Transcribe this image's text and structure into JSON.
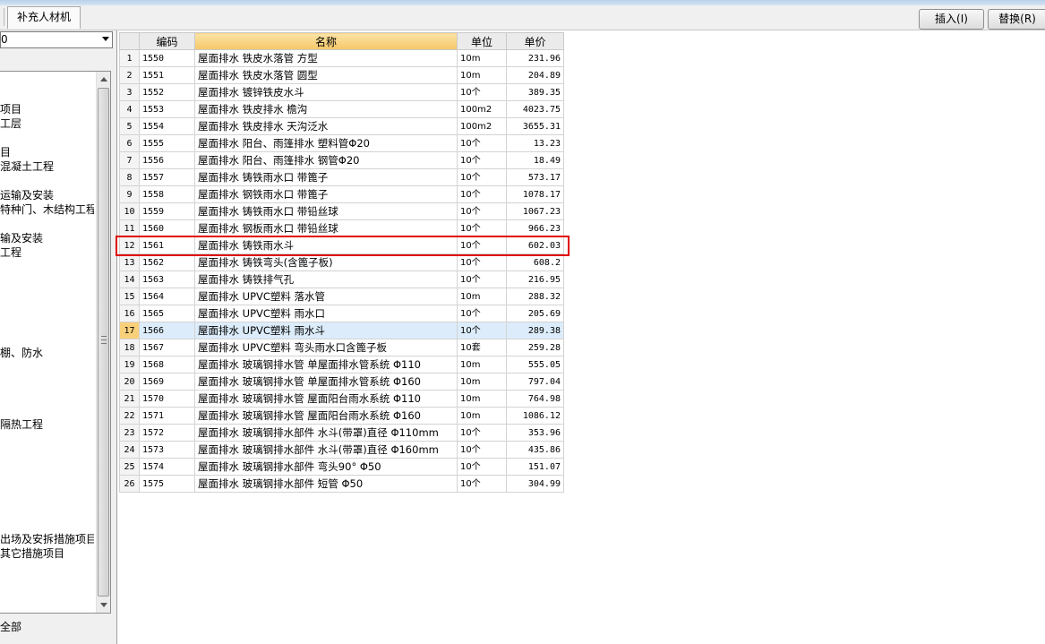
{
  "toolbar": {
    "tab_label": "补充人材机",
    "insert_label": "插入(I)",
    "replace_label": "替换(R)"
  },
  "left_panel": {
    "combo_value": "0",
    "tree_items": [
      "项目",
      "工层",
      "目",
      "混凝土工程",
      "运输及安装",
      "特种门、木结构工程",
      "输及安装",
      "工程",
      "棚、防水",
      "隔热工程",
      "出场及安拆措施项目",
      "其它措施项目"
    ],
    "all_label": "全部"
  },
  "grid": {
    "columns": [
      "编码",
      "名称",
      "单位",
      "单价"
    ],
    "active_column": "名称",
    "selected_row": 17,
    "highlighted_row": 12,
    "rows": [
      {
        "idx": "1",
        "code": "1550",
        "name": "屋面排水 铁皮水落管 方型",
        "unit": "10m",
        "price": "231.96"
      },
      {
        "idx": "2",
        "code": "1551",
        "name": "屋面排水 铁皮水落管 圆型",
        "unit": "10m",
        "price": "204.89"
      },
      {
        "idx": "3",
        "code": "1552",
        "name": "屋面排水 镀锌铁皮水斗",
        "unit": "10个",
        "price": "389.35"
      },
      {
        "idx": "4",
        "code": "1553",
        "name": "屋面排水 铁皮排水 檐沟",
        "unit": "100m2",
        "price": "4023.75"
      },
      {
        "idx": "5",
        "code": "1554",
        "name": "屋面排水 铁皮排水 天沟泛水",
        "unit": "100m2",
        "price": "3655.31"
      },
      {
        "idx": "6",
        "code": "1555",
        "name": "屋面排水 阳台、雨篷排水 塑料管Φ20",
        "unit": "10个",
        "price": "13.23"
      },
      {
        "idx": "7",
        "code": "1556",
        "name": "屋面排水 阳台、雨篷排水 钢管Φ20",
        "unit": "10个",
        "price": "18.49"
      },
      {
        "idx": "8",
        "code": "1557",
        "name": "屋面排水 铸铁雨水口 带篦子",
        "unit": "10个",
        "price": "573.17"
      },
      {
        "idx": "9",
        "code": "1558",
        "name": "屋面排水 钢铁雨水口 带篦子",
        "unit": "10个",
        "price": "1078.17"
      },
      {
        "idx": "10",
        "code": "1559",
        "name": "屋面排水 铸铁雨水口 带铅丝球",
        "unit": "10个",
        "price": "1067.23"
      },
      {
        "idx": "11",
        "code": "1560",
        "name": "屋面排水 钢板雨水口 带铅丝球",
        "unit": "10个",
        "price": "966.23"
      },
      {
        "idx": "12",
        "code": "1561",
        "name": "屋面排水 铸铁雨水斗",
        "unit": "10个",
        "price": "602.03"
      },
      {
        "idx": "13",
        "code": "1562",
        "name": "屋面排水 铸铁弯头(含篦子板)",
        "unit": "10个",
        "price": "608.2"
      },
      {
        "idx": "14",
        "code": "1563",
        "name": "屋面排水 铸铁排气孔",
        "unit": "10个",
        "price": "216.95"
      },
      {
        "idx": "15",
        "code": "1564",
        "name": "屋面排水 UPVC塑料 落水管",
        "unit": "10m",
        "price": "288.32"
      },
      {
        "idx": "16",
        "code": "1565",
        "name": "屋面排水 UPVC塑料 雨水口",
        "unit": "10个",
        "price": "205.69"
      },
      {
        "idx": "17",
        "code": "1566",
        "name": "屋面排水 UPVC塑料 雨水斗",
        "unit": "10个",
        "price": "289.38"
      },
      {
        "idx": "18",
        "code": "1567",
        "name": "屋面排水 UPVC塑料 弯头雨水口含篦子板",
        "unit": "10套",
        "price": "259.28"
      },
      {
        "idx": "19",
        "code": "1568",
        "name": "屋面排水 玻璃钢排水管 单屋面排水管系统 Φ110",
        "unit": "10m",
        "price": "555.05"
      },
      {
        "idx": "20",
        "code": "1569",
        "name": "屋面排水 玻璃钢排水管 单屋面排水管系统 Φ160",
        "unit": "10m",
        "price": "797.04"
      },
      {
        "idx": "21",
        "code": "1570",
        "name": "屋面排水 玻璃钢排水管 屋面阳台雨水系统 Φ110",
        "unit": "10m",
        "price": "764.98"
      },
      {
        "idx": "22",
        "code": "1571",
        "name": "屋面排水 玻璃钢排水管 屋面阳台雨水系统 Φ160",
        "unit": "10m",
        "price": "1086.12"
      },
      {
        "idx": "23",
        "code": "1572",
        "name": "屋面排水 玻璃钢排水部件 水斗(带罩)直径 Φ110mm",
        "unit": "10个",
        "price": "353.96"
      },
      {
        "idx": "24",
        "code": "1573",
        "name": "屋面排水 玻璃钢排水部件 水斗(带罩)直径 Φ160mm",
        "unit": "10个",
        "price": "435.86"
      },
      {
        "idx": "25",
        "code": "1574",
        "name": "屋面排水 玻璃钢排水部件 弯头90° Φ50",
        "unit": "10个",
        "price": "151.07"
      },
      {
        "idx": "26",
        "code": "1575",
        "name": "屋面排水 玻璃钢排水部件 短管 Φ50",
        "unit": "10个",
        "price": "304.99"
      }
    ]
  }
}
